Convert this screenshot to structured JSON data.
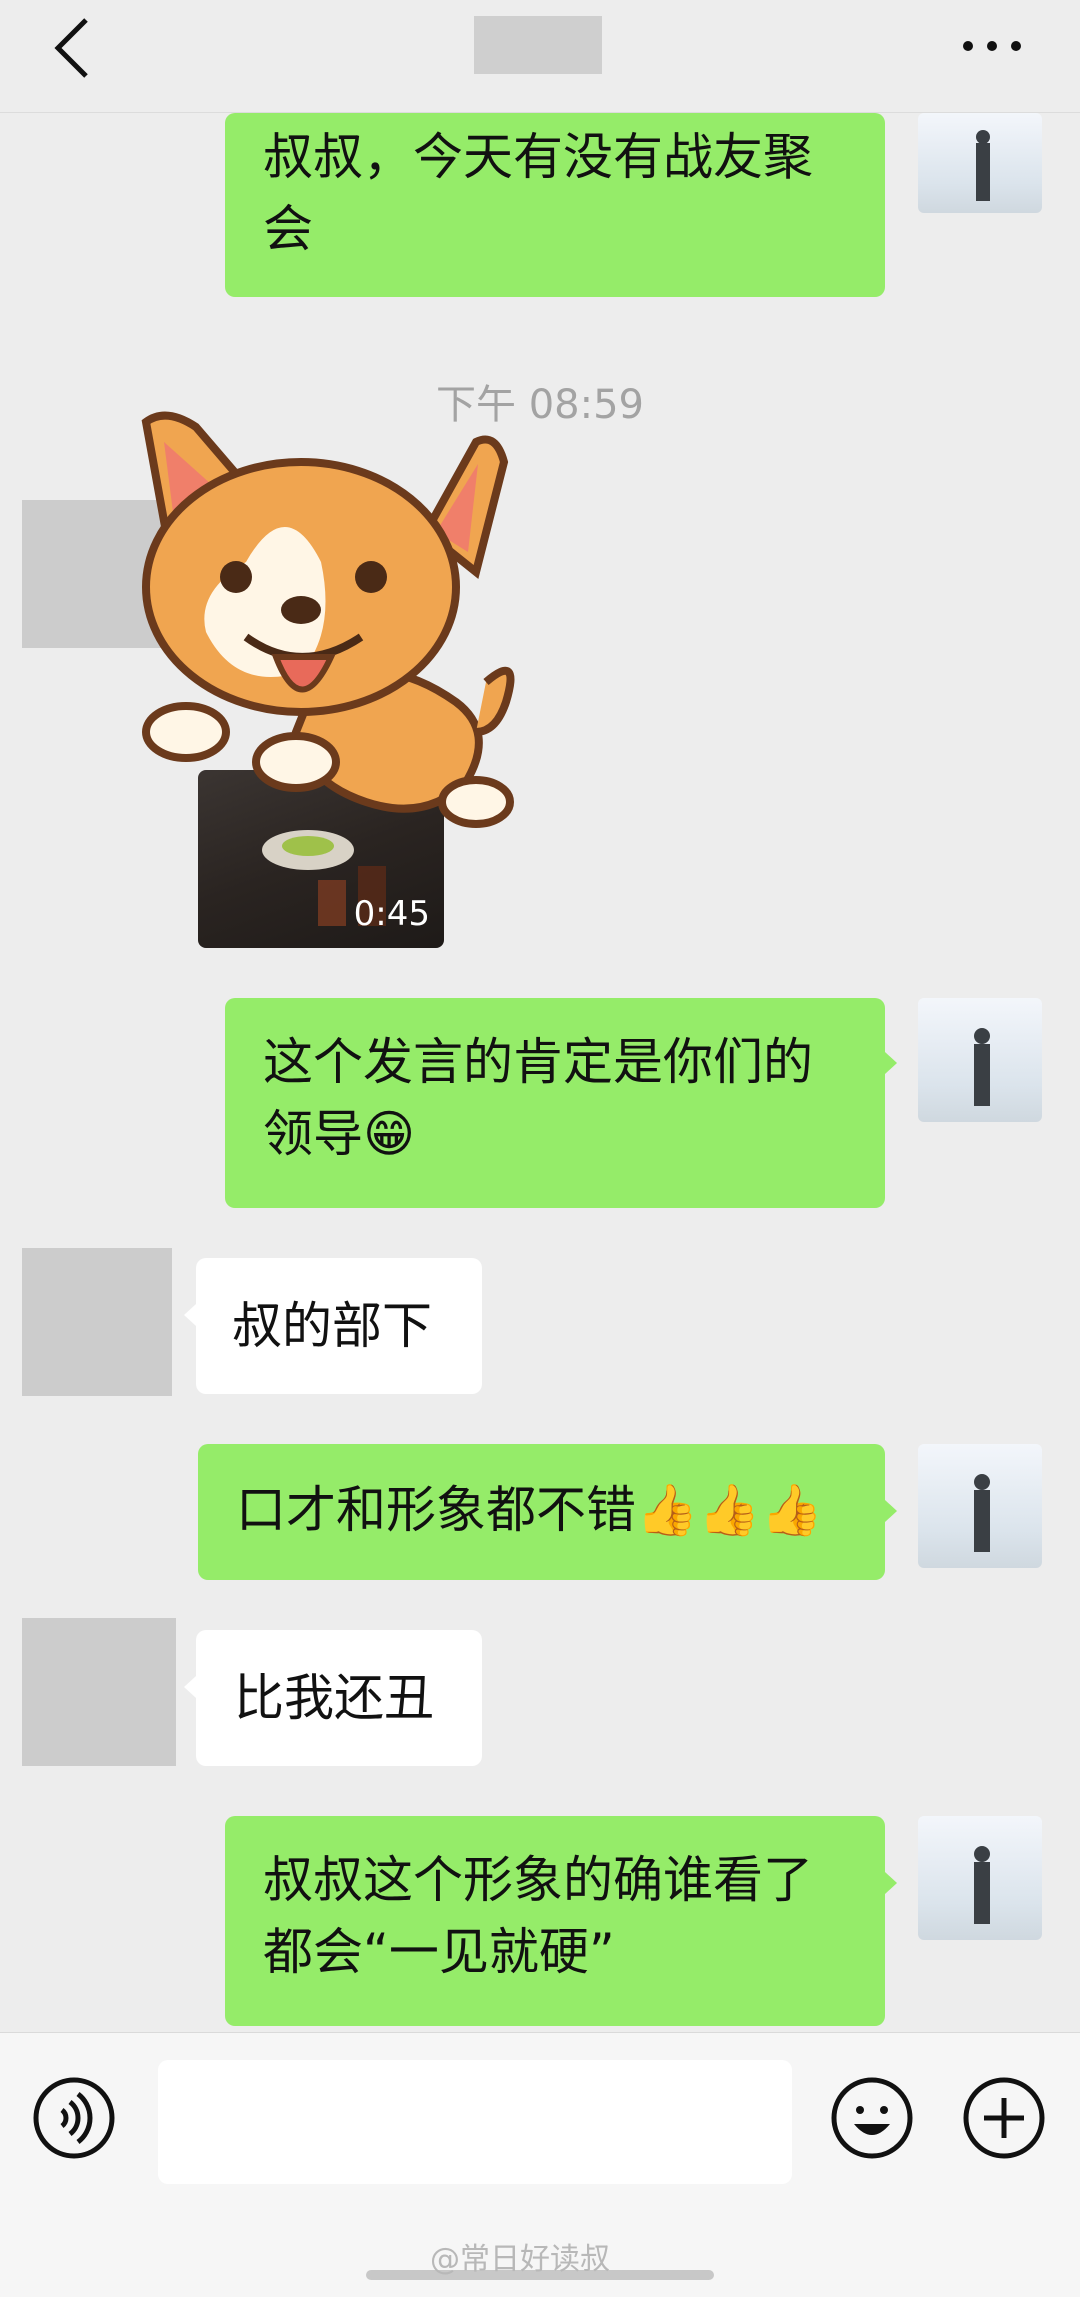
{
  "header": {
    "back_icon": "chevron-left-icon",
    "more_icon": "more-dots-icon"
  },
  "messages": [
    {
      "side": "right",
      "text_line1": "叔叔，今天有没有战友聚",
      "text_line2": "会"
    },
    {
      "timestamp": "下午 08:59"
    },
    {
      "side": "left",
      "type": "sticker+video",
      "sticker": "corgi-sticker",
      "video_duration": "0:45"
    },
    {
      "side": "right",
      "text_line1": "这个发言的肯定是你们的",
      "text_line2": "领导",
      "emoji": "😁"
    },
    {
      "side": "left",
      "text": "叔的部下"
    },
    {
      "side": "right",
      "text": "口才和形象都不错",
      "emoji": "👍👍👍"
    },
    {
      "side": "left",
      "text": "比我还丑"
    },
    {
      "side": "right",
      "text_line1": "叔叔这个形象的确谁看了",
      "text_line2": "都会“一见就硬”"
    }
  ],
  "input_bar": {
    "voice_icon": "voice-icon",
    "emoji_icon": "emoji-icon",
    "plus_icon": "plus-icon",
    "input_value": ""
  },
  "watermark": "@常日好读叔",
  "colors": {
    "background": "#ededed",
    "self_bubble": "#95ec69",
    "other_bubble": "#ffffff"
  }
}
